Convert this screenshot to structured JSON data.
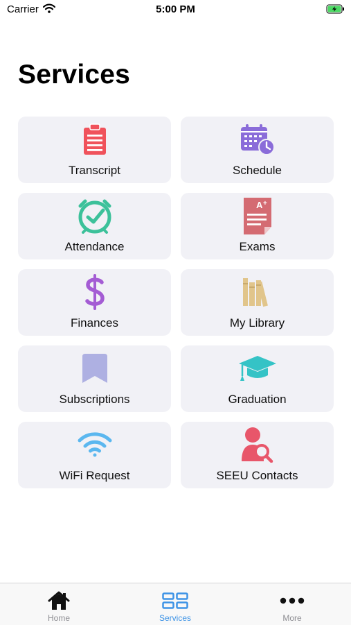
{
  "status_bar": {
    "carrier": "Carrier",
    "time": "5:00 PM"
  },
  "page": {
    "title": "Services"
  },
  "services": [
    {
      "label": "Transcript",
      "icon": "clipboard-icon",
      "color": "#f0525b"
    },
    {
      "label": "Schedule",
      "icon": "calendar-clock-icon",
      "color": "#8a6cd9"
    },
    {
      "label": "Attendance",
      "icon": "clock-check-icon",
      "color": "#3cc19a"
    },
    {
      "label": "Exams",
      "icon": "graded-paper-icon",
      "color": "#d46b72"
    },
    {
      "label": "Finances",
      "icon": "dollar-icon",
      "color": "#a45cd4"
    },
    {
      "label": "My Library",
      "icon": "books-icon",
      "color": "#e1c58b"
    },
    {
      "label": "Subscriptions",
      "icon": "bookmark-icon",
      "color": "#aeb0e2"
    },
    {
      "label": "Graduation",
      "icon": "graduation-cap-icon",
      "color": "#35c3c6"
    },
    {
      "label": "WiFi Request",
      "icon": "wifi-icon",
      "color": "#5bb7ef"
    },
    {
      "label": "SEEU Contacts",
      "icon": "person-search-icon",
      "color": "#e8566a"
    }
  ],
  "tab_bar": {
    "tabs": [
      {
        "label": "Home",
        "icon": "home-icon"
      },
      {
        "label": "Services",
        "icon": "grid-icon",
        "active": true
      },
      {
        "label": "More",
        "icon": "more-dots-icon"
      }
    ],
    "active_color": "#3d93e6"
  }
}
